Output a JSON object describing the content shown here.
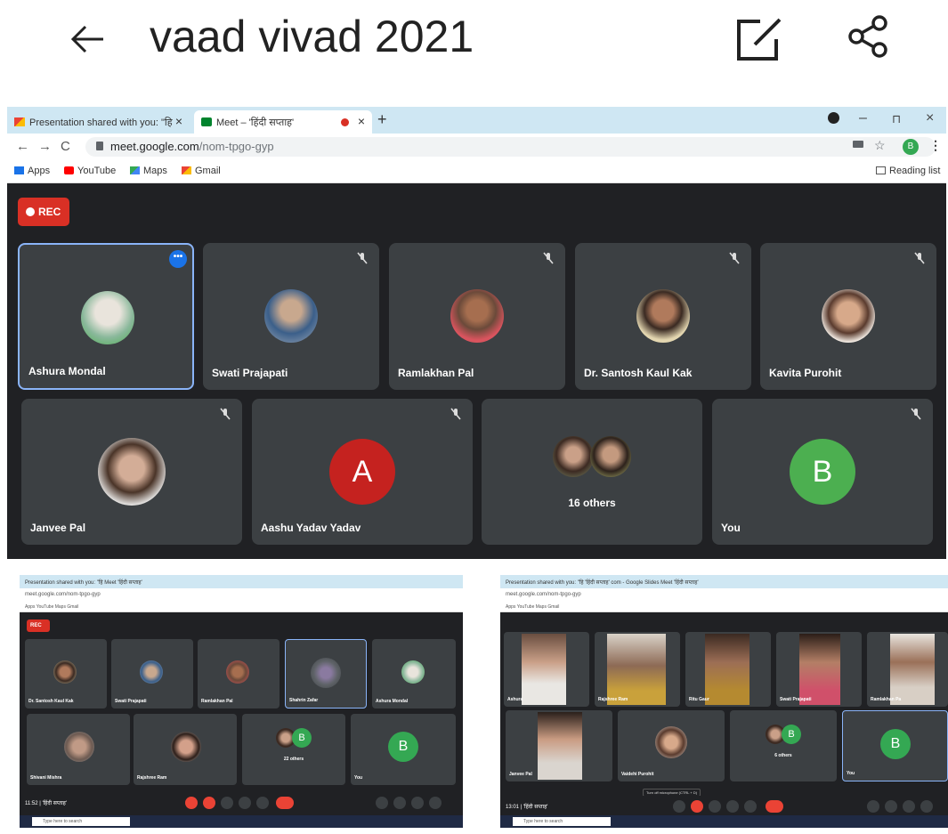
{
  "appbar": {
    "title": "vaad vivad 2021",
    "back_icon": "arrow-left-icon",
    "edit_icon": "edit-icon",
    "share_icon": "share-icon"
  },
  "browser": {
    "tab1_label": "Presentation shared with you: \"हि",
    "tab2_label": "Meet – 'हिंदी सप्ताह'",
    "url_domain": "meet.google.com",
    "url_path": "/nom-tpgo-gyp",
    "profile_letter": "B",
    "bookmarks": {
      "apps": "Apps",
      "youtube": "YouTube",
      "maps": "Maps",
      "gmail": "Gmail",
      "reading_list": "Reading list"
    }
  },
  "meeting": {
    "rec_label": "REC",
    "row1": [
      {
        "name": "Ashura Mondal",
        "active": true
      },
      {
        "name": "Swati Prajapati"
      },
      {
        "name": "Ramlakhan Pal"
      },
      {
        "name": "Dr. Santosh Kaul Kak"
      },
      {
        "name": "Kavita Purohit"
      }
    ],
    "row2": [
      {
        "name": "Janvee Pal"
      },
      {
        "name": "Aashu Yadav Yadav",
        "letter": "A"
      },
      {
        "name": "",
        "others": "16 others"
      },
      {
        "name": "You",
        "letter": "B"
      }
    ]
  },
  "thumb_left": {
    "rec_label": "REC",
    "url": "meet.google.com/nom-tpgo-gyp",
    "tabs": "Presentation shared with you: \"हि   Meet 'हिंदी सप्ताह'",
    "bookmarks": "Apps   YouTube   Maps   Gmail",
    "row1": [
      "Dr. Santosh Kaul Kak",
      "Swati Prajapati",
      "Ramlakhan Pal",
      "Shahrin Zafar",
      "Ashura Mondal"
    ],
    "row2": [
      "Shivani Mishra",
      "Rajshree Ram",
      "",
      "You"
    ],
    "others": "22 others",
    "you_letter": "B",
    "mini_letter": "B",
    "time": "11:52 | 'हिंदी सप्ताह'",
    "search": "Type here to search"
  },
  "thumb_right": {
    "url": "meet.google.com/nom-tpgo-gyp",
    "tabs": "Presentation shared with you: \"हि   'हिंदी सप्ताह' com - Google Slides   Meet 'हिंदी सप्ताह'",
    "bookmarks": "Apps   YouTube   Maps   Gmail",
    "row1": [
      "Ashura",
      "Rajshree Ram",
      "Ritu Gaur",
      "Swati Prajapati",
      "Ramlakhan Pa"
    ],
    "row2": [
      "Janvee Pal",
      "Vaidehi Purohit",
      "",
      "You"
    ],
    "others": "6 others",
    "you_letter": "B",
    "mini_letter": "B",
    "time": "13:01 | 'हिंदी सप्ताह'",
    "tooltip": "Turn off microphone (CTRL + D)",
    "search": "Type here to search"
  },
  "colors": {
    "meet_bg": "#202124",
    "tile_bg": "#3c4043",
    "rec": "#d93025",
    "active_border": "#8ab4f8",
    "avatar_a": "#c5221f",
    "avatar_b": "#4caf50"
  }
}
